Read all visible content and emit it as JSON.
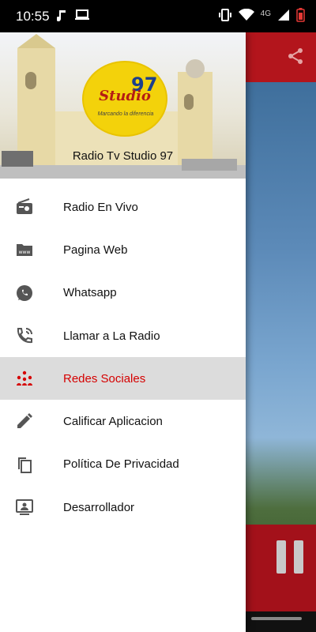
{
  "status_bar": {
    "time": "10:55",
    "network": "4G"
  },
  "drawer": {
    "station_name": "Radio Tv Studio 97",
    "logo": {
      "brand": "Studio",
      "number": "97",
      "slogan": "Marcando la diferencia"
    },
    "menu": [
      {
        "label": "Radio En Vivo",
        "icon": "radio-icon",
        "active": false
      },
      {
        "label": "Pagina Web",
        "icon": "www-folder-icon",
        "active": false
      },
      {
        "label": "Whatsapp",
        "icon": "whatsapp-icon",
        "active": false
      },
      {
        "label": "Llamar a La Radio",
        "icon": "phone-call-icon",
        "active": false
      },
      {
        "label": "Redes Sociales",
        "icon": "social-network-icon",
        "active": true
      },
      {
        "label": "Calificar Aplicacion",
        "icon": "pencil-icon",
        "active": false
      },
      {
        "label": "Política De Privacidad",
        "icon": "documents-icon",
        "active": false
      },
      {
        "label": "Desarrollador",
        "icon": "developer-icon",
        "active": false
      }
    ]
  },
  "colors": {
    "accent": "#d50000",
    "toolbar": "#b3151c",
    "active_bg": "#dcdcdc"
  }
}
